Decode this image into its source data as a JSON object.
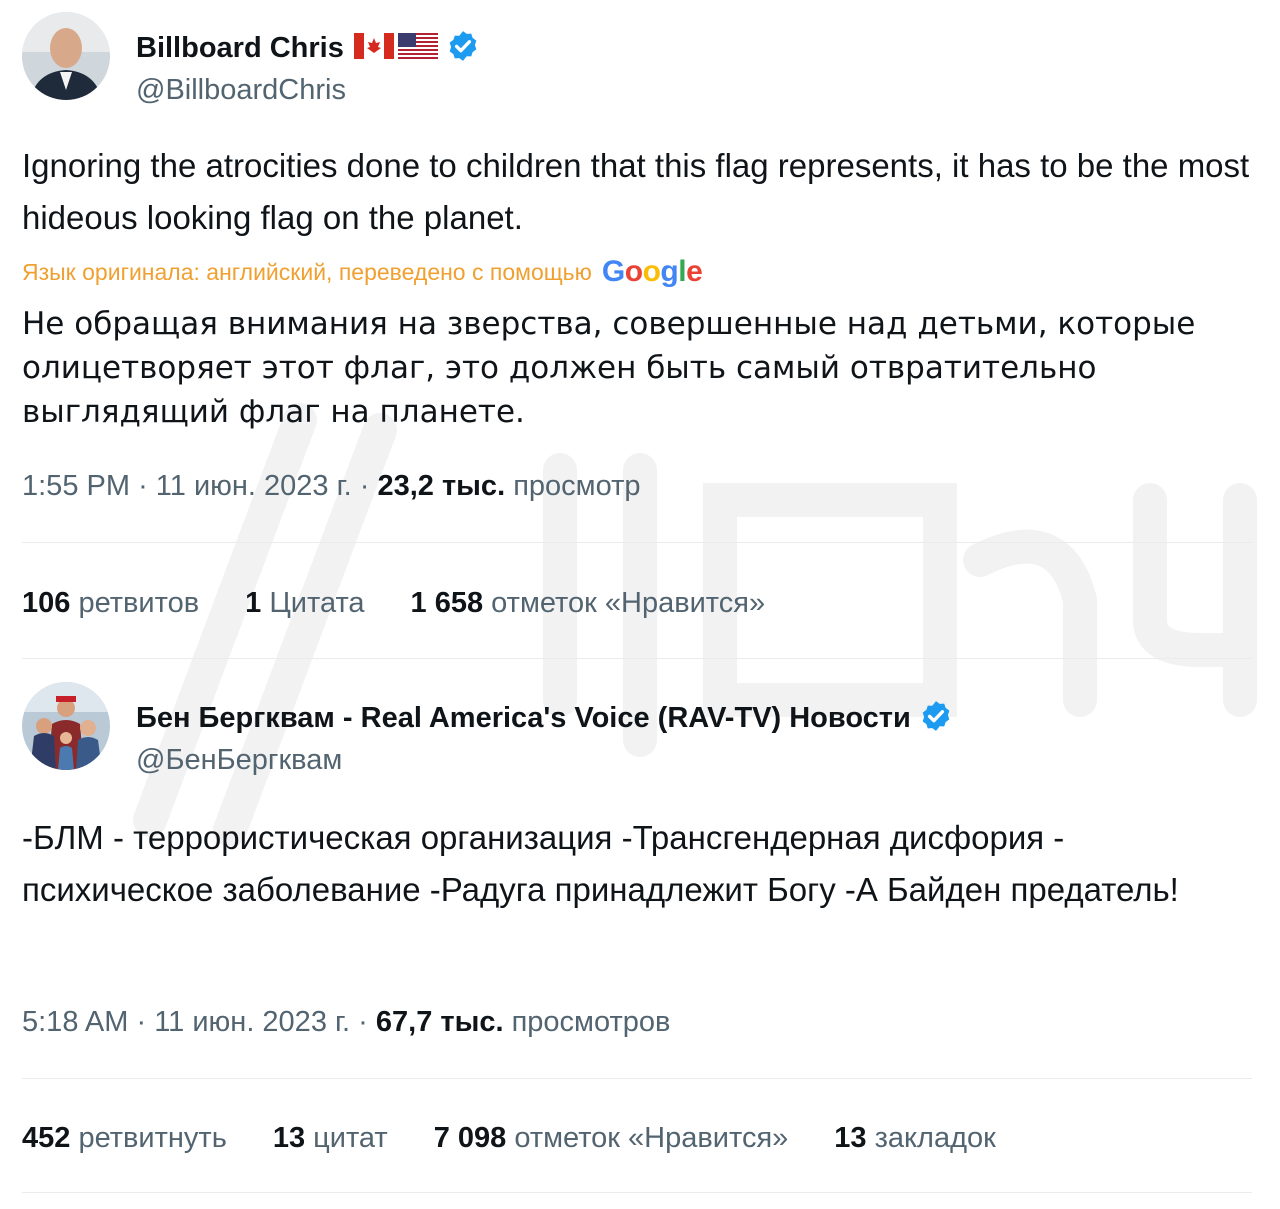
{
  "tweets": [
    {
      "display_name": "Billboard Chris",
      "flags": [
        "canada-flag",
        "usa-flag"
      ],
      "verified": true,
      "handle": "@BillboardChris",
      "text": "Ignoring the atrocities done to children that this flag represents, it has to be the most hideous looking flag on the planet.",
      "translation_note": "Язык оригинала: английский, переведено с помощью",
      "translation_provider": "Google",
      "translated_text": "Не обращая внимания на зверства, совершенные над детьми, которые олицетворяет этот флаг, это должен быть самый отвратительно выглядящий флаг на планете.",
      "time": "1:55 PM",
      "date": "11 июн. 2023 г.",
      "views_count": "23,2 тыс.",
      "views_label": "просмотр",
      "stats": [
        {
          "count": "106",
          "label": "ретвитов"
        },
        {
          "count": "1",
          "label": "Цитата"
        },
        {
          "count": "1 658",
          "label": "отметок «Нравится»"
        }
      ]
    },
    {
      "display_name": "Бен Бергквам - Real America's Voice (RAV-TV) Новости",
      "verified": true,
      "handle": "@БенБергквам",
      "text": "-БЛМ - террористическая организация -Трансгендерная дисфория - психическое заболевание -Радуга принадлежит Богу -А Байден предатель!",
      "time": "5:18 AM",
      "date": "11 июн. 2023 г.",
      "views_count": "67,7 тыс.",
      "views_label": "просмотров",
      "stats": [
        {
          "count": "452",
          "label": "ретвитнуть"
        },
        {
          "count": "13",
          "label": "цитат"
        },
        {
          "count": "7 098",
          "label": "отметок «Нравится»"
        },
        {
          "count": "13",
          "label": "закладок"
        }
      ]
    }
  ],
  "watermark": "Двач",
  "colors": {
    "text_primary": "#0f1419",
    "text_secondary": "#536471",
    "verified_blue": "#1d9bf0",
    "translation_orange": "#f0a030",
    "divider": "#e9ecee"
  }
}
